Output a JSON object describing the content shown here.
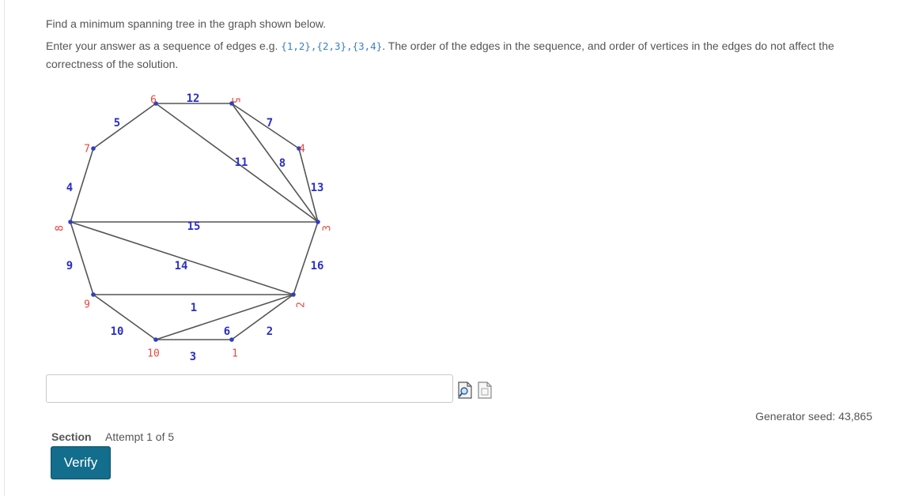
{
  "question": {
    "line1": "Find a minimum spanning tree in the graph shown below.",
    "line2_prefix": "Enter your answer as a sequence of edges e.g. ",
    "example_code": "{1,2},{2,3},{3,4}",
    "line2_suffix": ". The order of the edges in the sequence, and order of vertices in the edges do not affect the correctness of the solution."
  },
  "graph": {
    "vertices": [
      {
        "id": "1",
        "label": "1"
      },
      {
        "id": "2",
        "label": "2"
      },
      {
        "id": "3",
        "label": "3"
      },
      {
        "id": "4",
        "label": "4"
      },
      {
        "id": "5",
        "label": "5"
      },
      {
        "id": "6",
        "label": "6"
      },
      {
        "id": "7",
        "label": "7"
      },
      {
        "id": "8",
        "label": "8"
      },
      {
        "id": "9",
        "label": "9"
      },
      {
        "id": "10",
        "label": "10"
      }
    ],
    "edges": [
      {
        "u": "6",
        "v": "5",
        "weight": "12"
      },
      {
        "u": "7",
        "v": "6",
        "weight": "5"
      },
      {
        "u": "5",
        "v": "4",
        "weight": "7"
      },
      {
        "u": "6",
        "v": "3",
        "weight": "11"
      },
      {
        "u": "5",
        "v": "3",
        "weight": "8"
      },
      {
        "u": "4",
        "v": "3",
        "weight": "13"
      },
      {
        "u": "8",
        "v": "7",
        "weight": "4"
      },
      {
        "u": "8",
        "v": "3",
        "weight": "15"
      },
      {
        "u": "8",
        "v": "9",
        "weight": "9"
      },
      {
        "u": "8",
        "v": "2",
        "weight": "14"
      },
      {
        "u": "3",
        "v": "2",
        "weight": "16"
      },
      {
        "u": "9",
        "v": "2",
        "weight": "1"
      },
      {
        "u": "9",
        "v": "10",
        "weight": "10"
      },
      {
        "u": "10",
        "v": "2",
        "weight": "6"
      },
      {
        "u": "10",
        "v": "1",
        "weight": "3"
      },
      {
        "u": "1",
        "v": "2",
        "weight": "2"
      }
    ],
    "vertex_label_color": "#e8473c",
    "weight_label_color": "#2b2ec7",
    "edge_color": "#555555",
    "vertex_dot_color": "#2f3fbf"
  },
  "answer": {
    "value": "",
    "placeholder": ""
  },
  "icons": {
    "preview": "preview-icon",
    "help": "help-icon"
  },
  "seed_text": "Generator seed: 43,865",
  "section_label": "Section",
  "attempt_text": "Attempt 1 of 5",
  "verify_label": "Verify"
}
